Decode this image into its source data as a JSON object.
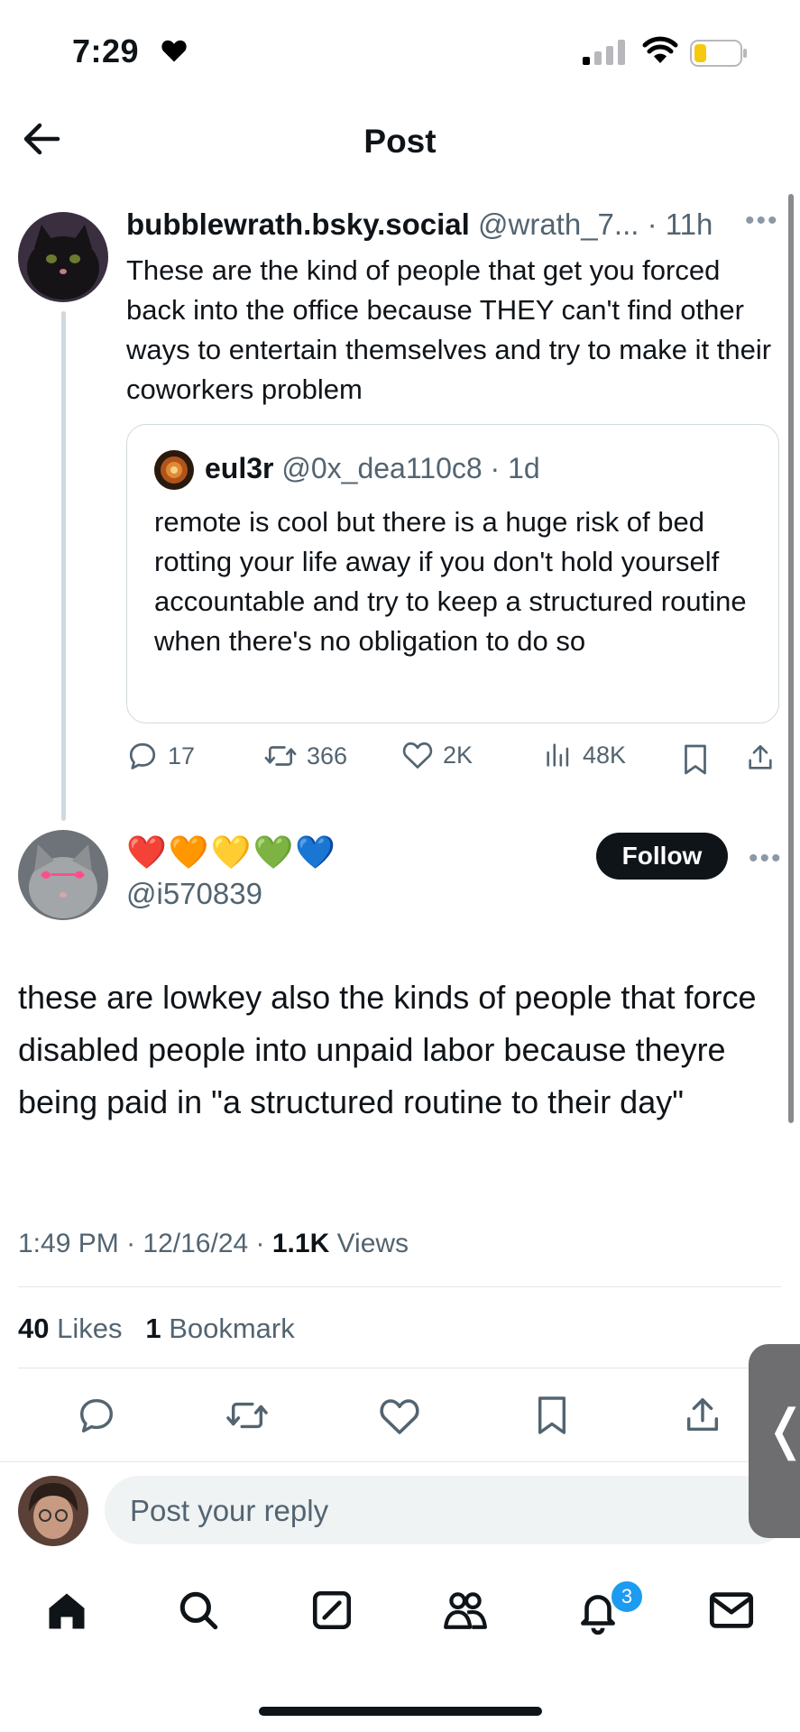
{
  "status_bar": {
    "time": "7:29",
    "heart_icon": "heart-icon",
    "signal": "cellular-signal-icon",
    "wifi": "wifi-icon",
    "battery": "battery-low-icon"
  },
  "header": {
    "title": "Post"
  },
  "parent_post": {
    "display_name": "bubblewrath.bsky.social",
    "handle_meta": "@wrath_7... · 11h",
    "text": "These are the kind of people that get you forced back into the office because THEY can't find other ways to entertain themselves and try to make it their coworkers problem",
    "quote": {
      "display_name": "eul3r",
      "handle_meta": "@0x_dea110c8 · 1d",
      "text": "remote is cool but there is a huge risk of bed rotting your life away if you don't hold yourself accountable and try to keep a structured routine when there's no obligation to do so"
    },
    "actions": {
      "replies": "17",
      "reposts": "366",
      "likes": "2K",
      "views": "48K"
    }
  },
  "main_post": {
    "display_name": "❤️🧡💛💚💙",
    "handle": "@i570839",
    "follow_label": "Follow",
    "text": "these are lowkey also the kinds of people that force disabled people into unpaid labor because theyre being paid in \"a structured routine to their day\"",
    "time": "1:49 PM",
    "date": "12/16/24",
    "views_count": "1.1K",
    "views_label": "Views",
    "likes_count": "40",
    "likes_label": "Likes",
    "bookmarks_count": "1",
    "bookmarks_label": "Bookmark"
  },
  "reply": {
    "placeholder": "Post your reply"
  },
  "tabbar": {
    "notifications_badge": "3"
  },
  "colors": {
    "text": "#0f1419",
    "muted": "#536471",
    "accent": "#1d9bf0",
    "border": "#cfd9de"
  }
}
